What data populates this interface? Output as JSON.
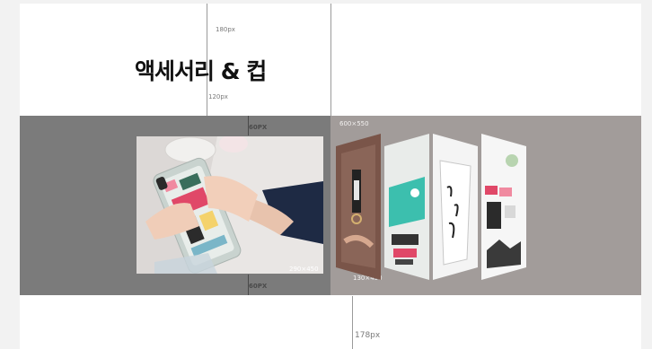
{
  "page": {
    "title": "액세서리 & 컵"
  },
  "guides": {
    "top_spacing": "180px",
    "title_spacing": "120px",
    "band_top_padding": "60PX",
    "band_bottom_padding": "60PX",
    "bottom_spacing": "178px"
  },
  "specs": {
    "right_panel_size": "600×550",
    "card_size": "130×450",
    "photo_size": "290×450"
  },
  "colors": {
    "band_left": "#7b7b7b",
    "band_right": "#a29c9a"
  }
}
